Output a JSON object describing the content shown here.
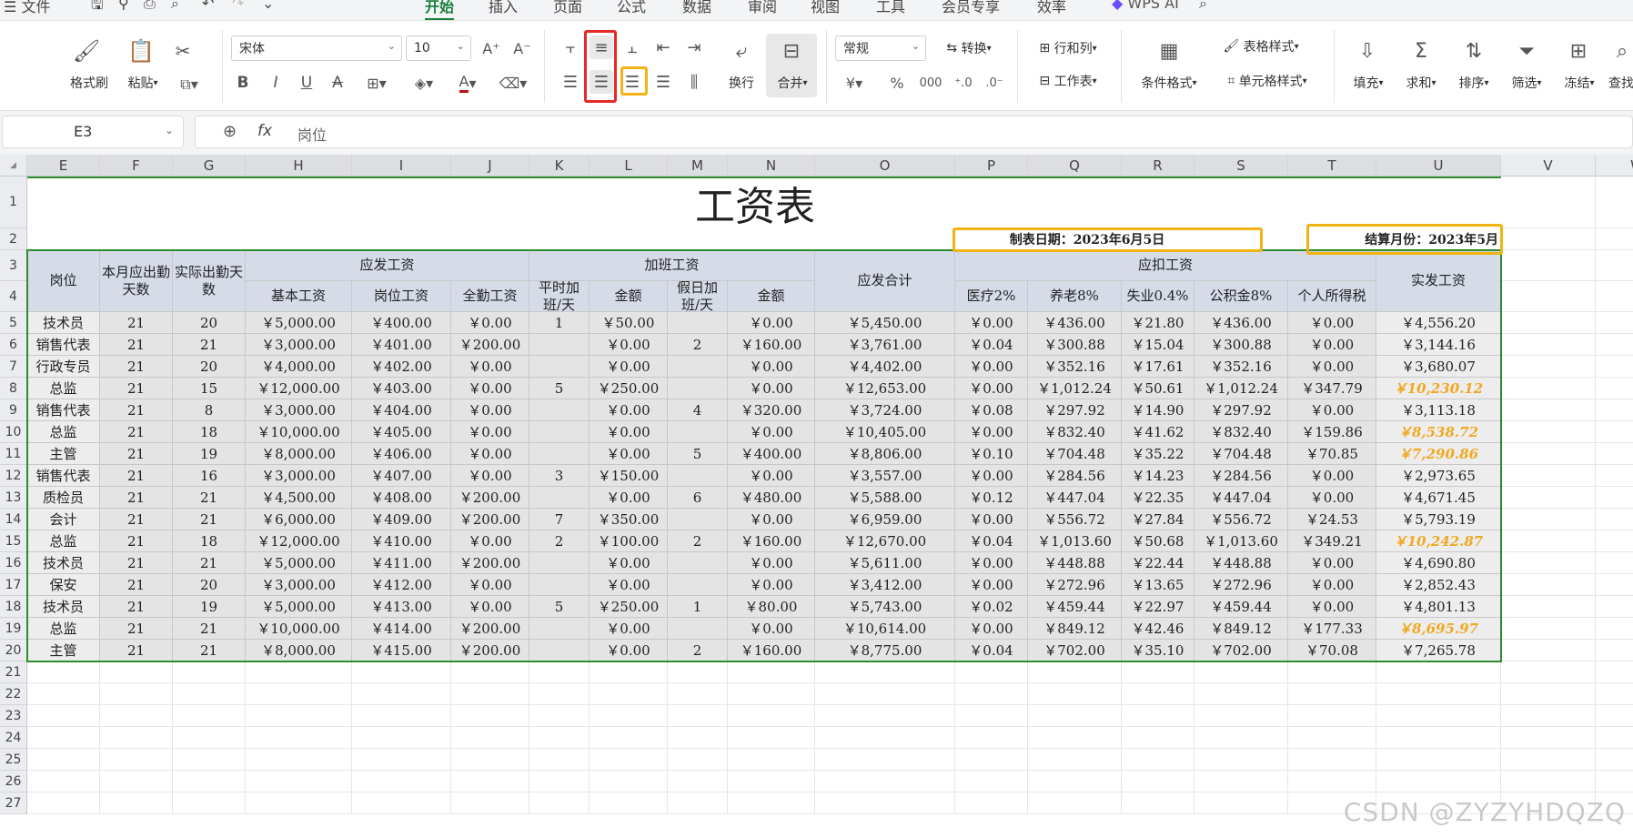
{
  "menu": {
    "file": "文件",
    "tabs": [
      "开始",
      "插入",
      "页面",
      "公式",
      "数据",
      "审阅",
      "视图",
      "工具",
      "会员专享",
      "效率"
    ],
    "active_tab": "开始",
    "wps_ai": "WPS AI"
  },
  "ribbon": {
    "format_painter": "格式刷",
    "paste": "粘贴",
    "font_name": "宋体",
    "font_size": "10",
    "wrap": "换行",
    "merge": "合并",
    "number_format": "常规",
    "convert": "转换",
    "row_col": "行和列",
    "worksheet": "工作表",
    "cond_format": "条件格式",
    "table_style": "表格样式",
    "cell_style": "单元格样式",
    "fill": "填充",
    "sum": "求和",
    "sort": "排序",
    "filter": "筛选",
    "freeze": "冻结",
    "find": "查找"
  },
  "formula_bar": {
    "cell_ref": "E3",
    "fx": "fx",
    "content": "岗位"
  },
  "columns": [
    "E",
    "F",
    "G",
    "H",
    "I",
    "J",
    "K",
    "L",
    "M",
    "N",
    "O",
    "P",
    "Q",
    "R",
    "S",
    "T",
    "U",
    "V",
    "W"
  ],
  "rows": [
    "1",
    "2",
    "3",
    "4",
    "5",
    "6",
    "7",
    "8",
    "9",
    "10",
    "11",
    "12",
    "13",
    "14",
    "15",
    "16",
    "17",
    "18",
    "19",
    "20",
    "21",
    "22",
    "23",
    "24",
    "25",
    "26",
    "27"
  ],
  "sheet": {
    "title": "工资表",
    "date_label": "制表日期：2023年6月5日",
    "month_label": "结算月份：2023年5月",
    "headers": {
      "position": "岗位",
      "should_days": "本月应出勤天数",
      "actual_days": "实际出勤天数",
      "gross_group": "应发工资",
      "basic": "基本工资",
      "post": "岗位工资",
      "attendance": "全勤工资",
      "overtime_group": "加班工资",
      "weekday_ot": "平时加班/天",
      "amount1": "金额",
      "holiday_ot": "假日加班/天",
      "amount2": "金额",
      "gross_total": "应发合计",
      "deduct_group": "应扣工资",
      "medical": "医疗2%",
      "pension": "养老8%",
      "unemployment": "失业0.4%",
      "housing": "公积金8%",
      "tax": "个人所得税",
      "net": "实发工资"
    },
    "data": [
      [
        "技术员",
        "21",
        "20",
        "￥5,000.00",
        "￥400.00",
        "￥0.00",
        "1",
        "￥50.00",
        "",
        "￥0.00",
        "￥5,450.00",
        "￥0.00",
        "￥436.00",
        "￥21.80",
        "￥436.00",
        "￥0.00",
        "￥4,556.20"
      ],
      [
        "销售代表",
        "21",
        "21",
        "￥3,000.00",
        "￥401.00",
        "￥200.00",
        "",
        "￥0.00",
        "2",
        "￥160.00",
        "￥3,761.00",
        "￥0.04",
        "￥300.88",
        "￥15.04",
        "￥300.88",
        "￥0.00",
        "￥3,144.16"
      ],
      [
        "行政专员",
        "21",
        "20",
        "￥4,000.00",
        "￥402.00",
        "￥0.00",
        "",
        "￥0.00",
        "",
        "￥0.00",
        "￥4,402.00",
        "￥0.00",
        "￥352.16",
        "￥17.61",
        "￥352.16",
        "￥0.00",
        "￥3,680.07"
      ],
      [
        "总监",
        "21",
        "15",
        "￥12,000.00",
        "￥403.00",
        "￥0.00",
        "5",
        "￥250.00",
        "",
        "￥0.00",
        "￥12,653.00",
        "￥0.00",
        "￥1,012.24",
        "￥50.61",
        "￥1,012.24",
        "￥347.79",
        "￥10,230.12"
      ],
      [
        "销售代表",
        "21",
        "8",
        "￥3,000.00",
        "￥404.00",
        "￥0.00",
        "",
        "￥0.00",
        "4",
        "￥320.00",
        "￥3,724.00",
        "￥0.08",
        "￥297.92",
        "￥14.90",
        "￥297.92",
        "￥0.00",
        "￥3,113.18"
      ],
      [
        "总监",
        "21",
        "18",
        "￥10,000.00",
        "￥405.00",
        "￥0.00",
        "",
        "￥0.00",
        "",
        "￥0.00",
        "￥10,405.00",
        "￥0.00",
        "￥832.40",
        "￥41.62",
        "￥832.40",
        "￥159.86",
        "￥8,538.72"
      ],
      [
        "主管",
        "21",
        "19",
        "￥8,000.00",
        "￥406.00",
        "￥0.00",
        "",
        "￥0.00",
        "5",
        "￥400.00",
        "￥8,806.00",
        "￥0.10",
        "￥704.48",
        "￥35.22",
        "￥704.48",
        "￥70.85",
        "￥7,290.86"
      ],
      [
        "销售代表",
        "21",
        "16",
        "￥3,000.00",
        "￥407.00",
        "￥0.00",
        "3",
        "￥150.00",
        "",
        "￥0.00",
        "￥3,557.00",
        "￥0.00",
        "￥284.56",
        "￥14.23",
        "￥284.56",
        "￥0.00",
        "￥2,973.65"
      ],
      [
        "质检员",
        "21",
        "21",
        "￥4,500.00",
        "￥408.00",
        "￥200.00",
        "",
        "￥0.00",
        "6",
        "￥480.00",
        "￥5,588.00",
        "￥0.12",
        "￥447.04",
        "￥22.35",
        "￥447.04",
        "￥0.00",
        "￥4,671.45"
      ],
      [
        "会计",
        "21",
        "21",
        "￥6,000.00",
        "￥409.00",
        "￥200.00",
        "7",
        "￥350.00",
        "",
        "￥0.00",
        "￥6,959.00",
        "￥0.00",
        "￥556.72",
        "￥27.84",
        "￥556.72",
        "￥24.53",
        "￥5,793.19"
      ],
      [
        "总监",
        "21",
        "18",
        "￥12,000.00",
        "￥410.00",
        "￥0.00",
        "2",
        "￥100.00",
        "2",
        "￥160.00",
        "￥12,670.00",
        "￥0.04",
        "￥1,013.60",
        "￥50.68",
        "￥1,013.60",
        "￥349.21",
        "￥10,242.87"
      ],
      [
        "技术员",
        "21",
        "21",
        "￥5,000.00",
        "￥411.00",
        "￥200.00",
        "",
        "￥0.00",
        "",
        "￥0.00",
        "￥5,611.00",
        "￥0.00",
        "￥448.88",
        "￥22.44",
        "￥448.88",
        "￥0.00",
        "￥4,690.80"
      ],
      [
        "保安",
        "21",
        "20",
        "￥3,000.00",
        "￥412.00",
        "￥0.00",
        "",
        "￥0.00",
        "",
        "￥0.00",
        "￥3,412.00",
        "￥0.00",
        "￥272.96",
        "￥13.65",
        "￥272.96",
        "￥0.00",
        "￥2,852.43"
      ],
      [
        "技术员",
        "21",
        "19",
        "￥5,000.00",
        "￥413.00",
        "￥0.00",
        "5",
        "￥250.00",
        "1",
        "￥80.00",
        "￥5,743.00",
        "￥0.02",
        "￥459.44",
        "￥22.97",
        "￥459.44",
        "￥0.00",
        "￥4,801.13"
      ],
      [
        "总监",
        "21",
        "21",
        "￥10,000.00",
        "￥414.00",
        "￥200.00",
        "",
        "￥0.00",
        "",
        "￥0.00",
        "￥10,614.00",
        "￥0.00",
        "￥849.12",
        "￥42.46",
        "￥849.12",
        "￥177.33",
        "￥8,695.97"
      ],
      [
        "主管",
        "21",
        "21",
        "￥8,000.00",
        "￥415.00",
        "￥200.00",
        "",
        "￥0.00",
        "2",
        "￥160.00",
        "￥8,775.00",
        "￥0.04",
        "￥702.00",
        "￥35.10",
        "￥702.00",
        "￥70.08",
        "￥7,265.78"
      ]
    ],
    "highlight_rows": [
      3,
      5,
      6,
      10,
      14
    ],
    "highlight_color": "#f0a820"
  },
  "watermark": "CSDN @ZYZYHDQZQ"
}
